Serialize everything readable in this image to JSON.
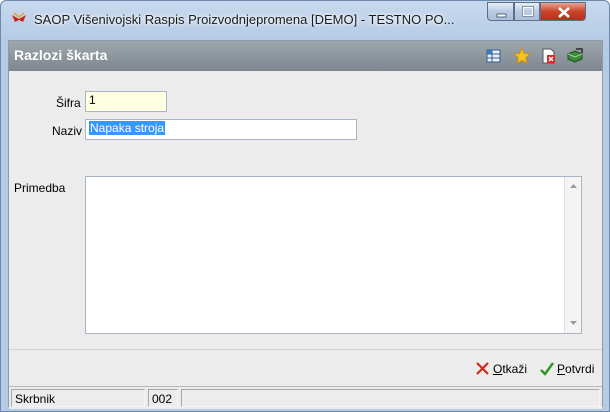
{
  "window": {
    "title": "SAOP Višenivojski Raspis Proizvodnjepromena [DEMO] - TESTNO PO...",
    "app_icon": "saop-logo-icon"
  },
  "header": {
    "title": "Razlozi škarta",
    "icons": [
      "grid-settings-icon",
      "star-icon",
      "document-delete-icon",
      "exit-icon"
    ]
  },
  "form": {
    "sifra_label": "Šifra",
    "sifra_value": "1",
    "naziv_label": "Naziv",
    "naziv_value": "Napaka stroja",
    "primedba_label": "Primedba",
    "primedba_value": ""
  },
  "actions": {
    "cancel_label": "Otkaži",
    "cancel_mnemonic": "O",
    "cancel_rest": "tkaži",
    "confirm_label": "Potvrdi",
    "confirm_mnemonic": "P",
    "confirm_rest": "otvrdi"
  },
  "status": {
    "user": "Skrbnik",
    "code": "002"
  },
  "colors": {
    "header_bg": "#8c949c",
    "sifra_bg": "#ffffe1",
    "selection": "#3399ff",
    "cancel_icon": "#d0281a",
    "confirm_icon": "#2a9a1e"
  }
}
